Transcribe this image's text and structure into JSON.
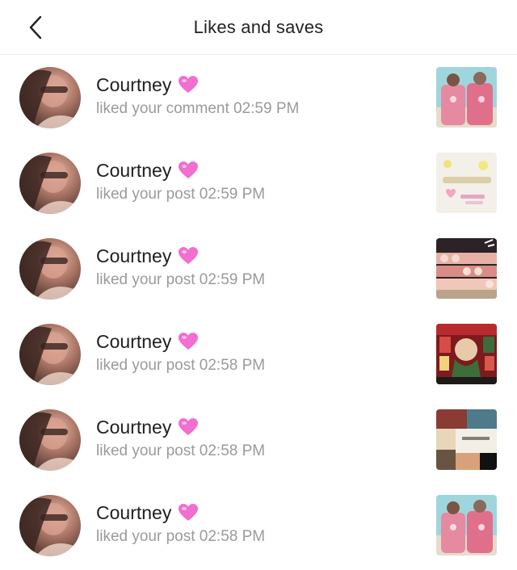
{
  "header": {
    "title": "Likes and saves",
    "back_icon": "chevron-left-icon"
  },
  "items": [
    {
      "name": "Courtney",
      "action": "liked your comment 02:59 PM",
      "thumb": "pink-jackets-photo"
    },
    {
      "name": "Courtney",
      "action": "liked your post 02:59 PM",
      "thumb": "cute-wedding-card"
    },
    {
      "name": "Courtney",
      "action": "liked your post 02:59 PM",
      "thumb": "candle-shelves-photo"
    },
    {
      "name": "Courtney",
      "action": "liked your post 02:58 PM",
      "thumb": "christmas-movie-collage"
    },
    {
      "name": "Courtney",
      "action": "liked your post 02:58 PM",
      "thumb": "holiday-collage"
    },
    {
      "name": "Courtney",
      "action": "liked your post 02:58 PM",
      "thumb": "pink-jackets-photo"
    }
  ],
  "colors": {
    "heart": "#f06fd0",
    "secondary_text": "#9a9a9a"
  }
}
